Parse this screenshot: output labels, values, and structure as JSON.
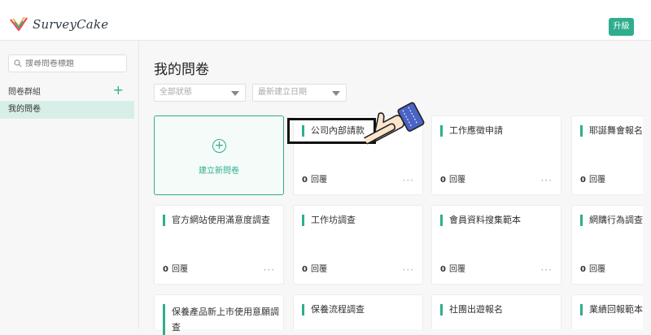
{
  "header": {
    "brand": "SurveyCake",
    "upgrade_label": "升級"
  },
  "sidebar": {
    "search_placeholder": "搜尋問卷標題",
    "group_label": "問卷群組",
    "group_add_icon": "plus-icon",
    "selected_item": "我的問卷"
  },
  "main": {
    "title": "我的問卷",
    "filters": [
      {
        "label": "全部狀態"
      },
      {
        "label": "最新建立日期"
      }
    ],
    "create_label": "建立新問卷",
    "cards": [
      {
        "title": "公司內部請款",
        "count": "0",
        "count_label": "回覆"
      },
      {
        "title": "工作應徵申請",
        "count": "0",
        "count_label": "回覆"
      },
      {
        "title": "耶誕舞會報名表",
        "count": "0",
        "count_label": "回覆"
      },
      {
        "title": "官方網站使用滿意度調查",
        "count": "0",
        "count_label": "回覆"
      },
      {
        "title": "工作坊調查",
        "count": "0",
        "count_label": "回覆"
      },
      {
        "title": "會員資料搜集範本",
        "count": "0",
        "count_label": "回覆"
      },
      {
        "title": "網購行為調查",
        "count": "0",
        "count_label": "回覆"
      },
      {
        "title": "保養產品新上市使用意願調查"
      },
      {
        "title": "保養流程調查"
      },
      {
        "title": "社團出遊報名"
      },
      {
        "title": "業績回報範本"
      }
    ],
    "more_label": "···"
  },
  "colors": {
    "accent": "#2fae8e",
    "selected_bg": "#d7efe8"
  }
}
